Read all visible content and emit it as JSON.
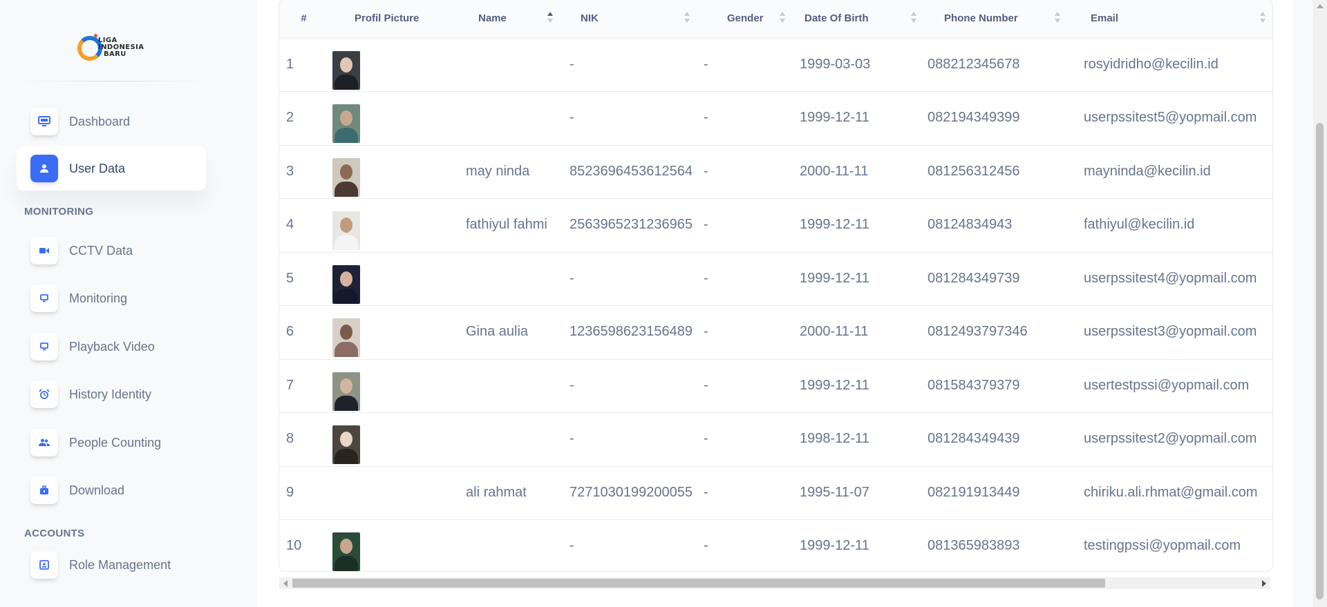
{
  "sidebar": {
    "logo": {
      "line1": "LIGA",
      "line2": "INDONESIA",
      "line3": "BARU"
    },
    "items": [
      {
        "label": "Dashboard",
        "icon": "monitor-icon"
      },
      {
        "label": "User Data",
        "icon": "user-icon"
      },
      {
        "label": "CCTV Data",
        "icon": "camera-icon"
      },
      {
        "label": "Monitoring",
        "icon": "monitor-icon"
      },
      {
        "label": "Playback Video",
        "icon": "monitor-icon"
      },
      {
        "label": "History Identity",
        "icon": "alarm-icon"
      },
      {
        "label": "People Counting",
        "icon": "users-icon"
      },
      {
        "label": "Download",
        "icon": "briefcase-icon"
      },
      {
        "label": "Role Management",
        "icon": "id-card-icon"
      }
    ],
    "sections": {
      "monitoring": "MONITORING",
      "accounts": "ACCOUNTS"
    }
  },
  "table": {
    "columns": [
      "#",
      "Profil Picture",
      "Name",
      "NIK",
      "Gender",
      "Date Of Birth",
      "Phone Number",
      "Email"
    ],
    "rows": [
      {
        "no": "1",
        "photo": "person-photo",
        "name": "",
        "nik": "-",
        "gender": "-",
        "dob": "1999-03-03",
        "phone": "088212345678",
        "email": "rosyidridho@kecilin.id"
      },
      {
        "no": "2",
        "photo": "person-photo",
        "name": "",
        "nik": "-",
        "gender": "-",
        "dob": "1999-12-11",
        "phone": "082194349399",
        "email": "userpssitest5@yopmail.com"
      },
      {
        "no": "3",
        "photo": "person-photo",
        "name": "may ninda",
        "nik": "8523696453612564",
        "gender": "-",
        "dob": "2000-11-11",
        "phone": "081256312456",
        "email": "mayninda@kecilin.id"
      },
      {
        "no": "4",
        "photo": "person-photo",
        "name": "fathiyul fahmi",
        "nik": "2563965231236965",
        "gender": "-",
        "dob": "1999-12-11",
        "phone": "08124834943",
        "email": "fathiyul@kecilin.id"
      },
      {
        "no": "5",
        "photo": "person-photo",
        "name": "",
        "nik": "-",
        "gender": "-",
        "dob": "1999-12-11",
        "phone": "081284349739",
        "email": "userpssitest4@yopmail.com"
      },
      {
        "no": "6",
        "photo": "person-photo",
        "name": "Gina aulia",
        "nik": "1236598623156489",
        "gender": "-",
        "dob": "2000-11-11",
        "phone": "0812493797346",
        "email": "userpssitest3@yopmail.com"
      },
      {
        "no": "7",
        "photo": "person-photo",
        "name": "",
        "nik": "-",
        "gender": "-",
        "dob": "1999-12-11",
        "phone": "081584379379",
        "email": "usertestpssi@yopmail.com"
      },
      {
        "no": "8",
        "photo": "person-photo",
        "name": "",
        "nik": "-",
        "gender": "-",
        "dob": "1998-12-11",
        "phone": "081284349439",
        "email": "userpssitest2@yopmail.com"
      },
      {
        "no": "9",
        "photo": "",
        "name": "ali rahmat",
        "nik": "7271030199200055",
        "gender": "-",
        "dob": "1995-11-07",
        "phone": "082191913449",
        "email": "chiriku.ali.rhmat@gmail.com"
      },
      {
        "no": "10",
        "photo": "person-photo",
        "name": "",
        "nik": "-",
        "gender": "-",
        "dob": "1999-12-11",
        "phone": "081365983893",
        "email": "testingpssi@yopmail.com"
      }
    ]
  }
}
